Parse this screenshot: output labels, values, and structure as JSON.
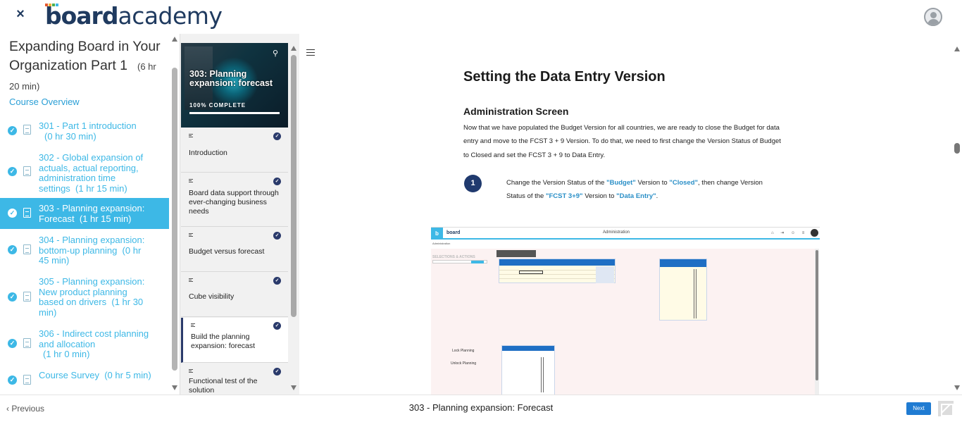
{
  "brand": {
    "logo_bold": "board",
    "logo_light": "academy",
    "accent": "#3db8e6",
    "dark": "#1f3a5f"
  },
  "topbar": {
    "close_icon": "close-icon",
    "close_glyph": "×",
    "avatar_icon": "user-avatar-icon"
  },
  "sidebar": {
    "course_title": "Expanding Board in Your Organization Part 1",
    "course_duration": "(6 hr 20 min)",
    "overview_label": "Course Overview",
    "lessons": [
      {
        "label": "301 - Part 1 introduction",
        "duration": "(0 hr 30 min)",
        "active": false
      },
      {
        "label": "302 - Global expansion of actuals, actual reporting, administration time settings",
        "duration": "(1 hr 15 min)",
        "active": false
      },
      {
        "label": "303 - Planning expansion: Forecast",
        "duration": "(1 hr 15 min)",
        "active": true
      },
      {
        "label": "304 - Planning expansion: bottom-up planning",
        "duration": "(0 hr 45 min)",
        "active": false
      },
      {
        "label": "305 - Planning expansion: New product planning based on drivers",
        "duration": "(1 hr 30 min)",
        "active": false
      },
      {
        "label": "306 - Indirect cost planning and allocation",
        "duration": "(1 hr 0 min)",
        "active": false
      },
      {
        "label": "Course Survey",
        "duration": "(0 hr 5 min)",
        "active": false
      }
    ]
  },
  "chapters": {
    "header_title": "303: Planning expansion: forecast",
    "progress_label": "100% COMPLETE",
    "progress": 1.0,
    "items": [
      {
        "label": "Introduction",
        "done": true,
        "current": false
      },
      {
        "label": "Board data support through ever-changing business needs",
        "done": true,
        "current": false
      },
      {
        "label": "Budget versus forecast",
        "done": true,
        "current": false
      },
      {
        "label": "Cube visibility",
        "done": true,
        "current": false
      },
      {
        "label": "Build the planning expansion: forecast",
        "done": true,
        "current": true
      },
      {
        "label": "Functional test of the solution",
        "done": true,
        "current": false
      }
    ]
  },
  "content": {
    "title": "Setting the Data Entry Version",
    "section": "Administration Screen",
    "paragraph": "Now that we have populated the Budget Version for all countries, we are ready to close the Budget for data entry and move to the FCST 3 + 9 Version. To do that, we need to first change the Version Status of Budget to Closed and set the FCST 3 + 9 to Data Entry.",
    "step_number": "1",
    "step": {
      "t1": "Change the Version Status of the ",
      "h1": "\"Budget\"",
      "t2": " Version to ",
      "h2": "\"Closed\"",
      "t3": ", then change Version Status of the ",
      "h3": "\"FCST 3+9\"",
      "t4": " Version to ",
      "h4": "\"Data Entry\"",
      "t5": "."
    },
    "screenshot": {
      "logo_letter": "b",
      "app_name": "board",
      "window_title": "Administration",
      "breadcrumb": "Administration",
      "selections_label": "SELECTIONS & ACTIONS",
      "lock_label": "Lock Planning",
      "unlock_label": "Unlock Planning"
    }
  },
  "footer": {
    "prev_label": "‹ Previous",
    "title": "303 - Planning expansion: Forecast",
    "next_label": "Next"
  }
}
